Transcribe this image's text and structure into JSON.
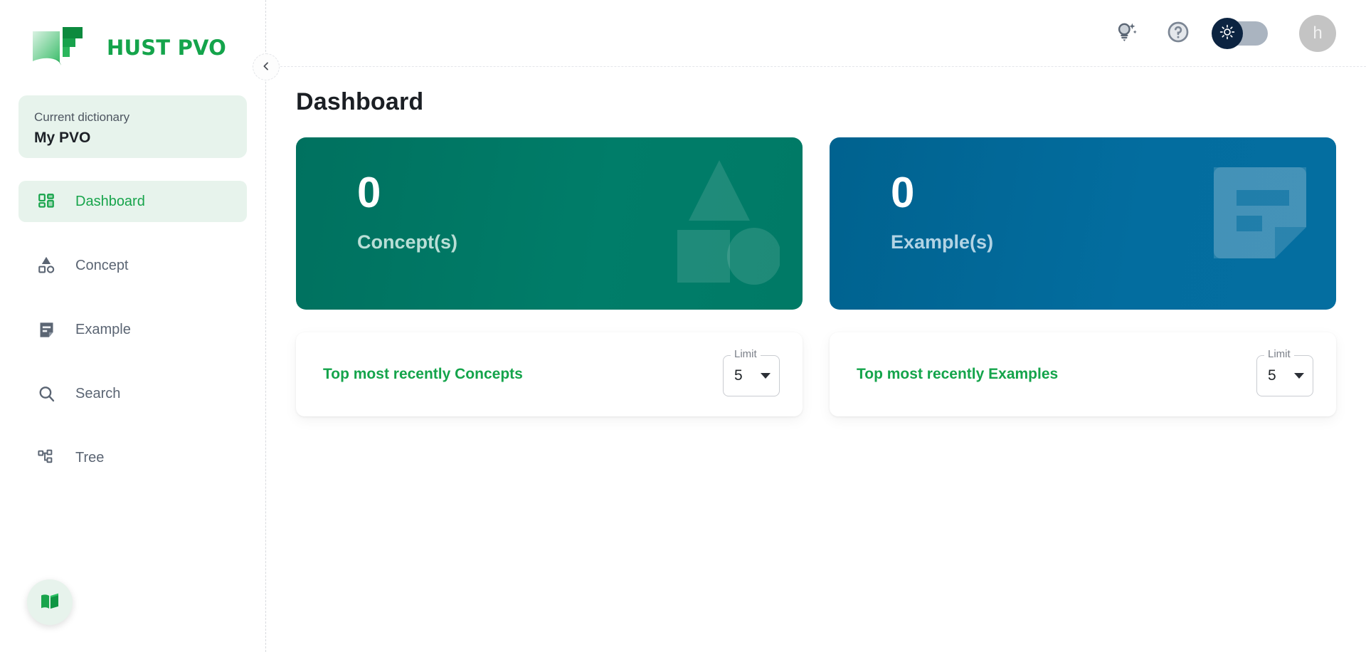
{
  "brand": {
    "name": "HUST PVO",
    "logo_icon": "open-book-logo",
    "green": "#14a44b"
  },
  "sidebar": {
    "dictionary": {
      "label": "Current dictionary",
      "value": "My PVO"
    },
    "items": [
      {
        "label": "Dashboard",
        "icon": "dashboard-grid-icon",
        "active": true
      },
      {
        "label": "Concept",
        "icon": "shapes-icon",
        "active": false
      },
      {
        "label": "Example",
        "icon": "note-icon",
        "active": false
      },
      {
        "label": "Search",
        "icon": "search-icon",
        "active": false
      },
      {
        "label": "Tree",
        "icon": "account-tree-icon",
        "active": false
      }
    ],
    "fab": {
      "icon": "menu-book-icon",
      "title": "Dictionary"
    },
    "collapse": {
      "icon": "chevron-left-icon",
      "title": "Collapse sidebar"
    }
  },
  "topbar": {
    "tips": {
      "icon": "lightbulb-sparkle-icon",
      "title": "Tips"
    },
    "help": {
      "icon": "help-circle-icon",
      "title": "Help"
    },
    "theme_toggle": {
      "icon": "sun-icon",
      "title": "Theme",
      "state": "light"
    },
    "avatar": {
      "initial": "h"
    }
  },
  "main": {
    "page_title": "Dashboard",
    "stats": [
      {
        "count": "0",
        "label": "Concept(s)",
        "color": "#007a66",
        "deco": "shapes-triangle-square-circle"
      },
      {
        "count": "0",
        "label": "Example(s)",
        "color": "#046ea0",
        "deco": "sticky-note"
      }
    ],
    "lists": [
      {
        "title": "Top most recently Concepts",
        "limit_label": "Limit",
        "limit_value": "5"
      },
      {
        "title": "Top most recently Examples",
        "limit_label": "Limit",
        "limit_value": "5"
      }
    ]
  }
}
